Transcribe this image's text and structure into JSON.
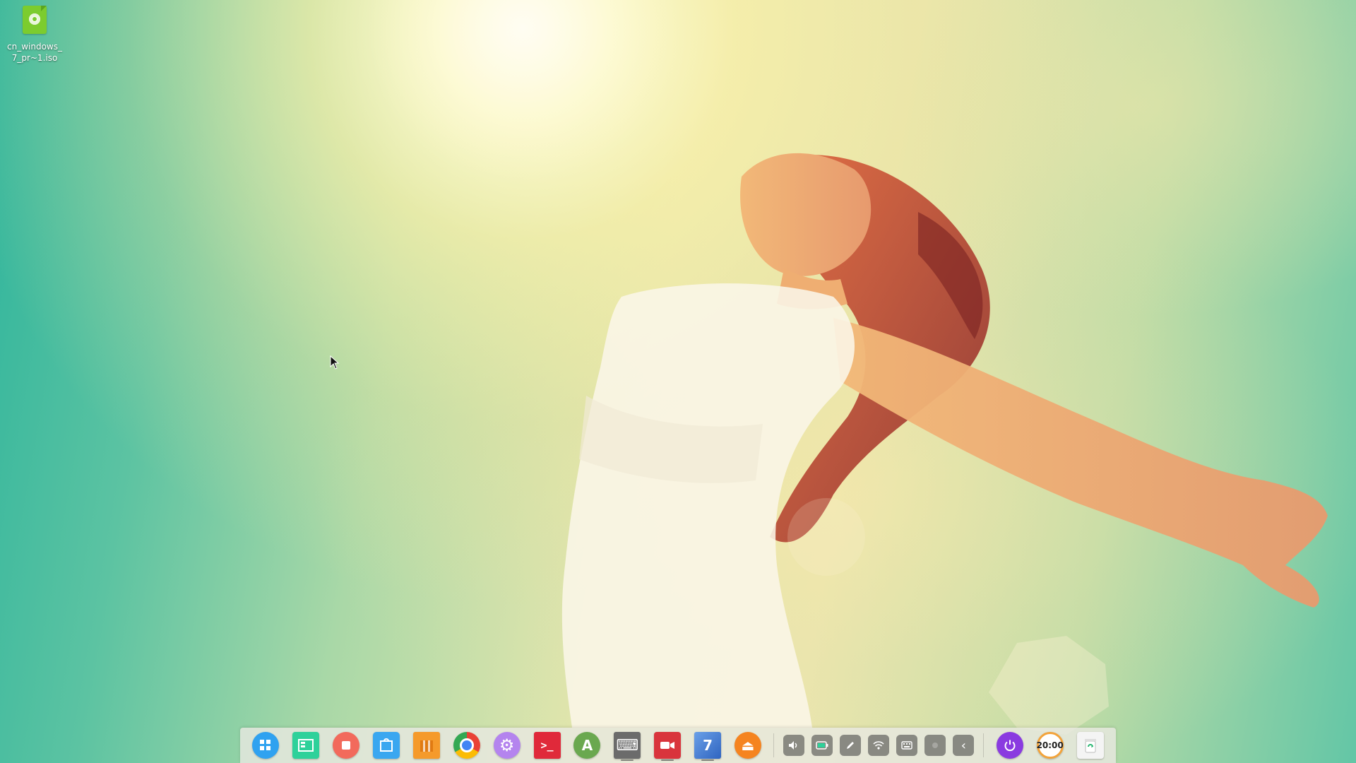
{
  "desktop": {
    "icons": [
      {
        "label": "cn_windows_7_pr~1.iso",
        "icon": "disc-image-icon",
        "color": "#7ccc2e"
      }
    ]
  },
  "dock": {
    "apps": [
      {
        "name": "launcher",
        "icon": "launcher-icon",
        "color": "#2fa2f0",
        "glyph": "▦"
      },
      {
        "name": "multitasking",
        "icon": "multitask-view-icon",
        "color": "#2ed19a",
        "glyph": "▤"
      },
      {
        "name": "screen-recorder",
        "icon": "screen-recorder-icon",
        "color": "#f26a5c",
        "glyph": "■"
      },
      {
        "name": "app-store",
        "icon": "app-store-icon",
        "color": "#3aa7f0",
        "glyph": "◫"
      },
      {
        "name": "archive-manager",
        "icon": "archive-icon",
        "color": "#f59a2b",
        "glyph": "▥"
      },
      {
        "name": "chrome",
        "icon": "chrome-icon",
        "color": "#e94235",
        "glyph": "◉"
      },
      {
        "name": "settings",
        "icon": "gear-icon",
        "color": "#a064e6",
        "glyph": "⚙"
      },
      {
        "name": "terminal",
        "icon": "terminal-icon",
        "color": "#e0293a",
        "glyph": ">_"
      },
      {
        "name": "android-studio",
        "icon": "android-studio-icon",
        "color": "#6aa84f",
        "glyph": "A"
      },
      {
        "name": "keyboard-tool",
        "icon": "keyboard-app-icon",
        "color": "#6b6b6b",
        "glyph": "⌨"
      },
      {
        "name": "video-recorder",
        "icon": "camera-icon",
        "color": "#d9343c",
        "glyph": "●"
      },
      {
        "name": "windows-7-vm",
        "icon": "virtual-machine-icon",
        "color": "#3f7fd8",
        "glyph": "7"
      },
      {
        "name": "vlc-player",
        "icon": "eject-icon",
        "color": "#f58420",
        "glyph": "⏏"
      }
    ],
    "running": [
      "keyboard-tool",
      "video-recorder",
      "windows-7-vm"
    ],
    "tray": [
      {
        "name": "volume",
        "icon": "volume-icon",
        "glyph": "🔈"
      },
      {
        "name": "battery",
        "icon": "battery-icon",
        "glyph": "▭"
      },
      {
        "name": "pen",
        "icon": "pen-icon",
        "glyph": "✎"
      },
      {
        "name": "wifi",
        "icon": "wifi-icon",
        "glyph": "◠"
      },
      {
        "name": "keyboard",
        "icon": "keyboard-icon",
        "glyph": "⌨"
      },
      {
        "name": "blank",
        "icon": "dot-icon",
        "glyph": "·"
      },
      {
        "name": "collapse",
        "icon": "chevron-left-icon",
        "glyph": "‹"
      }
    ],
    "power": {
      "icon": "power-icon",
      "color": "#8a3be0"
    },
    "clock": {
      "text": "20:00"
    },
    "trash": {
      "icon": "trash-icon",
      "color": "#2bb673"
    }
  }
}
